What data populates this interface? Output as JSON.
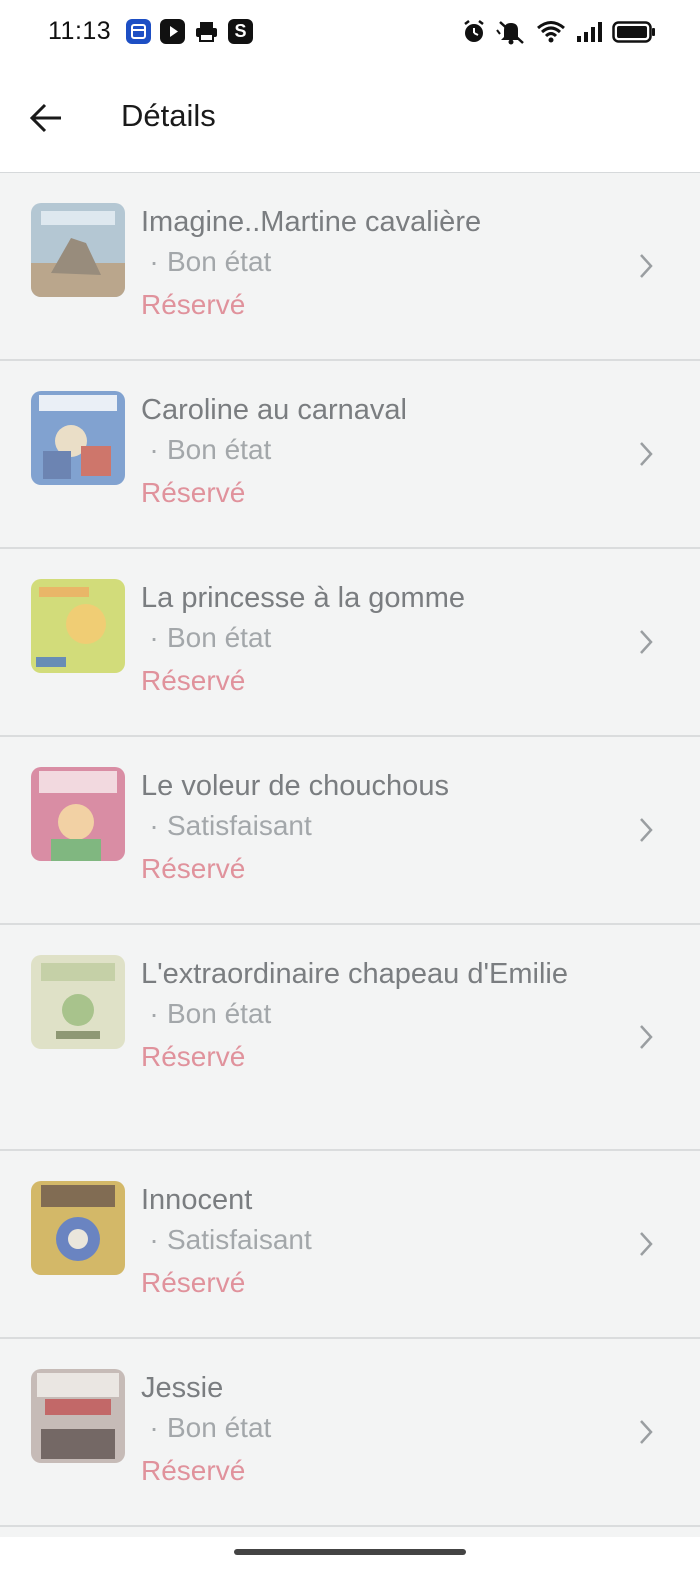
{
  "status_bar": {
    "time": "11:13",
    "app_icons": [
      "calendar-app-icon",
      "youtube-icon",
      "printer-icon",
      "s-app-icon"
    ],
    "app_letters": [
      "",
      "",
      "",
      "S"
    ],
    "system_icons": [
      "alarm-icon",
      "mute-icon",
      "wifi-icon",
      "signal-icon",
      "battery-icon"
    ]
  },
  "header": {
    "back_icon": "arrow-left-icon",
    "title": "Détails"
  },
  "items": [
    {
      "title": "Imagine..Martine cavalière",
      "condition": "Bon état",
      "status": "Réservé"
    },
    {
      "title": "Caroline au carnaval",
      "condition": "Bon état",
      "status": "Réservé"
    },
    {
      "title": "La princesse à la gomme",
      "condition": "Bon état",
      "status": "Réservé"
    },
    {
      "title": "Le voleur de chouchous",
      "condition": "Satisfaisant",
      "status": "Réservé"
    },
    {
      "title": "L'extraordinaire chapeau d'Emilie",
      "condition": "Bon état",
      "status": "Réservé"
    },
    {
      "title": "Innocent",
      "condition": "Satisfaisant",
      "status": "Réservé"
    },
    {
      "title": "Jessie",
      "condition": "Bon état",
      "status": "Réservé"
    }
  ],
  "condition_prefix": "·",
  "colors": {
    "status_reserved": "#e0929c",
    "title_text": "#7a7d80",
    "condition_text": "#a3a7aa",
    "list_background": "#f3f4f4"
  }
}
